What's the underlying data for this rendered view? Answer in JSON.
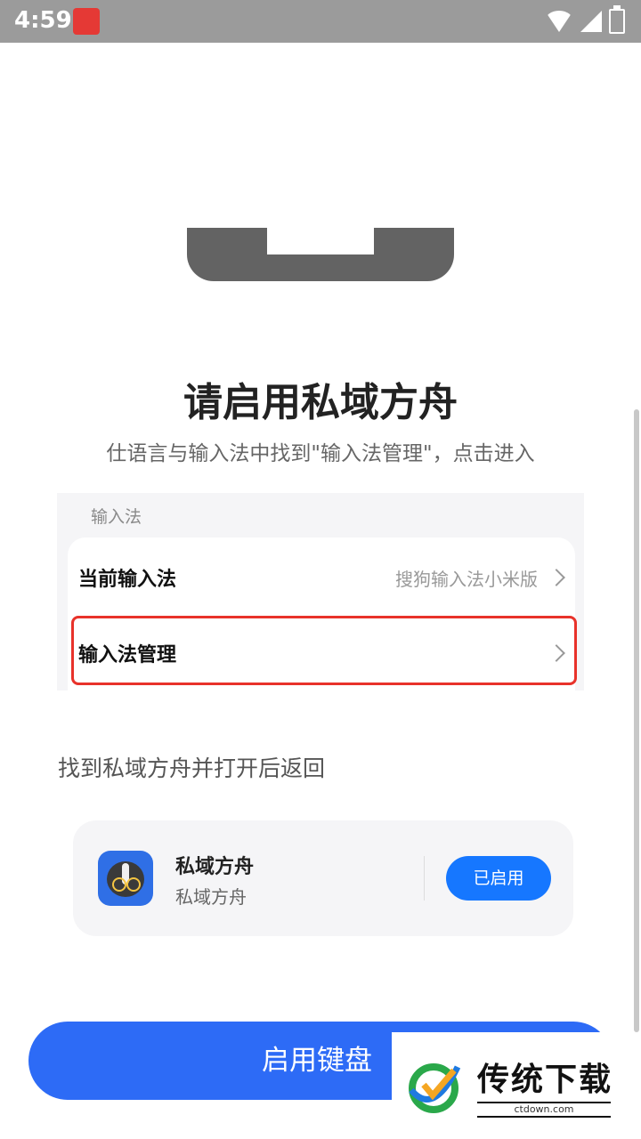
{
  "status_bar": {
    "time": "4:59"
  },
  "title": "请启用私域方舟",
  "subtitle": "仕语言与输入法中找到\"输入法管理\"，点击进入",
  "settings": {
    "section_label": "输入法",
    "rows": [
      {
        "label": "当前输入法",
        "value": "搜狗输入法小米版"
      },
      {
        "label": "输入法管理",
        "value": ""
      }
    ]
  },
  "hint": "找到私域方舟并打开后返回",
  "app_card": {
    "name": "私域方舟",
    "subtitle": "私域方舟",
    "button_label": "已启用"
  },
  "primary_button": "启用键盘",
  "watermark": {
    "title": "传统下载",
    "url": "ctdown.com"
  },
  "colors": {
    "primary": "#2d6bf6",
    "accent": "#1677ff",
    "highlight": "#e8322a"
  }
}
